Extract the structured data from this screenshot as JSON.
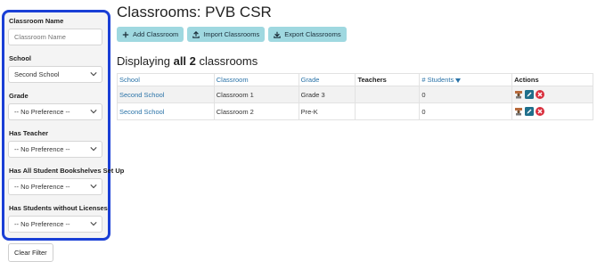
{
  "sidebar": {
    "classroom_name": {
      "label": "Classroom Name",
      "placeholder": "Classroom Name",
      "value": ""
    },
    "school": {
      "label": "School",
      "value": "Second School"
    },
    "grade": {
      "label": "Grade",
      "value": "-- No Preference --"
    },
    "has_teacher": {
      "label": "Has Teacher",
      "value": "-- No Preference --"
    },
    "bookshelves": {
      "label": "Has All Student Bookshelves Set Up",
      "value": "-- No Preference --"
    },
    "licenses": {
      "label": "Has Students without Licenses",
      "value": "-- No Preference --"
    },
    "clear_filter": "Clear Filter"
  },
  "main": {
    "title": "Classrooms: PVB CSR",
    "toolbar": {
      "add": "Add Classroom",
      "import": "Import Classrooms",
      "export": "Export Classrooms"
    },
    "displaying_prefix": "Displaying ",
    "displaying_bold": "all 2",
    "displaying_suffix": " classrooms",
    "table": {
      "headers": {
        "school": "School",
        "classroom": "Classroom",
        "grade": "Grade",
        "teachers": "Teachers",
        "students": "# Students",
        "actions": "Actions"
      },
      "rows": [
        {
          "school": "Second School",
          "classroom": "Classroom 1",
          "grade": "Grade 3",
          "teachers": "",
          "students": "0"
        },
        {
          "school": "Second School",
          "classroom": "Classroom 2",
          "grade": "Pre-K",
          "teachers": "",
          "students": "0"
        }
      ]
    }
  },
  "icons": {
    "add": "plus-icon",
    "import": "upload-icon",
    "export": "download-icon",
    "sort": "sort-down-icon",
    "teacher": "teacher-icon",
    "edit": "edit-icon",
    "delete": "delete-icon"
  },
  "colors": {
    "sidebar_border": "#1a3fd6",
    "toolbar_button": "#9fd8e0",
    "link": "#2a73a8",
    "edit": "#1f6f8b",
    "delete": "#d9303e"
  }
}
